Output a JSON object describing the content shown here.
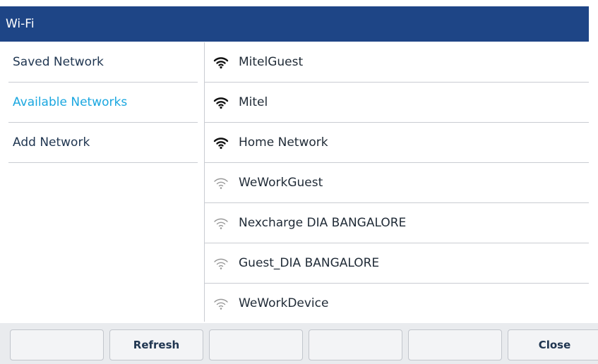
{
  "titlebar": {
    "title": "Wi-Fi",
    "background": "#1e4586"
  },
  "sidebar": {
    "items": [
      {
        "label": "Saved Network",
        "active": false
      },
      {
        "label": "Available Networks",
        "active": true
      },
      {
        "label": "Add Network",
        "active": false
      }
    ],
    "active_color": "#1aa7e0"
  },
  "networks": [
    {
      "ssid": "MitelGuest",
      "signal": "strong",
      "icon": "wifi-strong-icon"
    },
    {
      "ssid": "Mitel",
      "signal": "strong",
      "icon": "wifi-strong-icon"
    },
    {
      "ssid": "Home Network",
      "signal": "strong",
      "icon": "wifi-strong-icon"
    },
    {
      "ssid": "WeWorkGuest",
      "signal": "weak",
      "icon": "wifi-weak-icon"
    },
    {
      "ssid": "Nexcharge DIA BANGALORE",
      "signal": "weak",
      "icon": "wifi-weak-icon"
    },
    {
      "ssid": "Guest_DIA BANGALORE",
      "signal": "weak",
      "icon": "wifi-weak-icon"
    },
    {
      "ssid": "WeWorkDevice",
      "signal": "weak",
      "icon": "wifi-weak-icon"
    }
  ],
  "softkeys": [
    {
      "label": ""
    },
    {
      "label": "Refresh"
    },
    {
      "label": ""
    },
    {
      "label": ""
    },
    {
      "label": ""
    },
    {
      "label": "Close"
    }
  ]
}
